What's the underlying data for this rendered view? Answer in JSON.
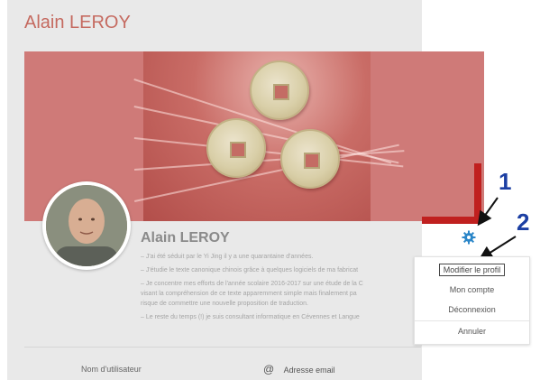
{
  "page": {
    "title": "Alain LEROY"
  },
  "profile": {
    "name": "Alain LEROY",
    "bio": [
      "– J'ai été séduit par le Yi Jing il y a une quarantaine d'années.",
      "– J'étudie le texte canonique chinois grâce à quelques logiciels de ma fabricat",
      "– Je concentre mes efforts de l'année scolaire 2016-2017 sur une étude de la C",
      "visant la compréhension de ce texte apparemment simple mais finalement pa",
      "risque de commettre une nouvelle proposition de traduction.",
      "– Le reste du temps (!) je suis consultant informatique en Cévennes et Langue"
    ]
  },
  "fields": {
    "username_label": "Nom d'utilisateur",
    "email_icon": "@",
    "email_label": "Adresse email"
  },
  "settings_icon": "gear-icon",
  "menu": {
    "items": [
      "Modifier le profil",
      "Mon compte",
      "Déconnexion",
      "Annuler"
    ]
  },
  "annotations": {
    "step1": "1",
    "step2": "2"
  },
  "colors": {
    "title": "#c56a60",
    "banner": "#cf7a78",
    "annotation_red": "#c0201f",
    "annotation_blue": "#1c3fa3",
    "gear": "#2b86c8"
  }
}
